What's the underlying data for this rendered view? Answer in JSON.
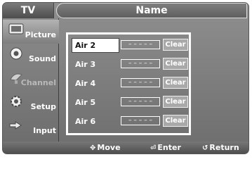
{
  "header": {
    "menu_title": "TV",
    "page_title": "Name"
  },
  "sidebar": {
    "items": [
      {
        "label": "Picture",
        "icon": "picture-icon",
        "state": "active"
      },
      {
        "label": "Sound",
        "icon": "speaker-icon",
        "state": "normal"
      },
      {
        "label": "Channel",
        "icon": "satellite-dish-icon",
        "state": "disabled"
      },
      {
        "label": "Setup",
        "icon": "gear-icon",
        "state": "normal"
      },
      {
        "label": "Input",
        "icon": "input-plug-icon",
        "state": "normal"
      }
    ]
  },
  "inputs": {
    "rows": [
      {
        "name": "Air 2",
        "value": "– – – – –",
        "button": "Clear"
      },
      {
        "name": "Air 3",
        "value": "– – – – –",
        "button": "Clear"
      },
      {
        "name": "Air 4",
        "value": "– – – – –",
        "button": "Clear"
      },
      {
        "name": "Air 5",
        "value": "– – – – –",
        "button": "Clear"
      },
      {
        "name": "Air 6",
        "value": "– – – – –",
        "button": "Clear"
      }
    ],
    "selected": "Air 2"
  },
  "footer": {
    "move": "Move",
    "enter": "Enter",
    "return": "Return",
    "move_icon": "move-arrows-icon",
    "enter_icon": "enter-icon",
    "return_icon": "return-arrow-icon"
  },
  "colors": {
    "background": "#7d7d7d",
    "highlight": "#ffffff",
    "button": "#a9a9a9"
  }
}
